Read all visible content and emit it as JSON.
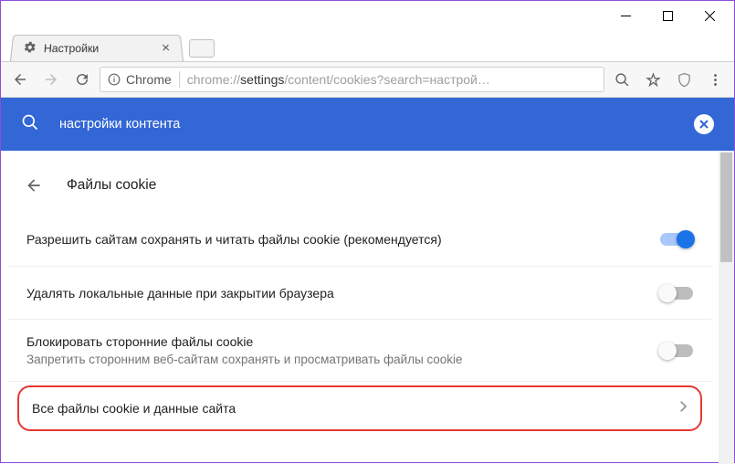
{
  "window": {
    "tab_title": "Настройки"
  },
  "omnibox": {
    "secure_label": "Chrome",
    "url_prefix": "chrome://",
    "url_dark": "settings",
    "url_suffix": "/content/cookies?search=настрой…"
  },
  "search": {
    "query": "настройки контента"
  },
  "page": {
    "title": "Файлы cookie"
  },
  "settings": [
    {
      "label": "Разрешить сайтам сохранять и читать файлы cookie (рекомендуется)",
      "sub": "",
      "on": true
    },
    {
      "label": "Удалять локальные данные при закрытии браузера",
      "sub": "",
      "on": false
    },
    {
      "label": "Блокировать сторонние файлы cookie",
      "sub": "Запретить сторонним веб-сайтам сохранять и просматривать файлы cookie",
      "on": false
    }
  ],
  "link_row": {
    "label": "Все файлы cookie и данные сайта"
  }
}
